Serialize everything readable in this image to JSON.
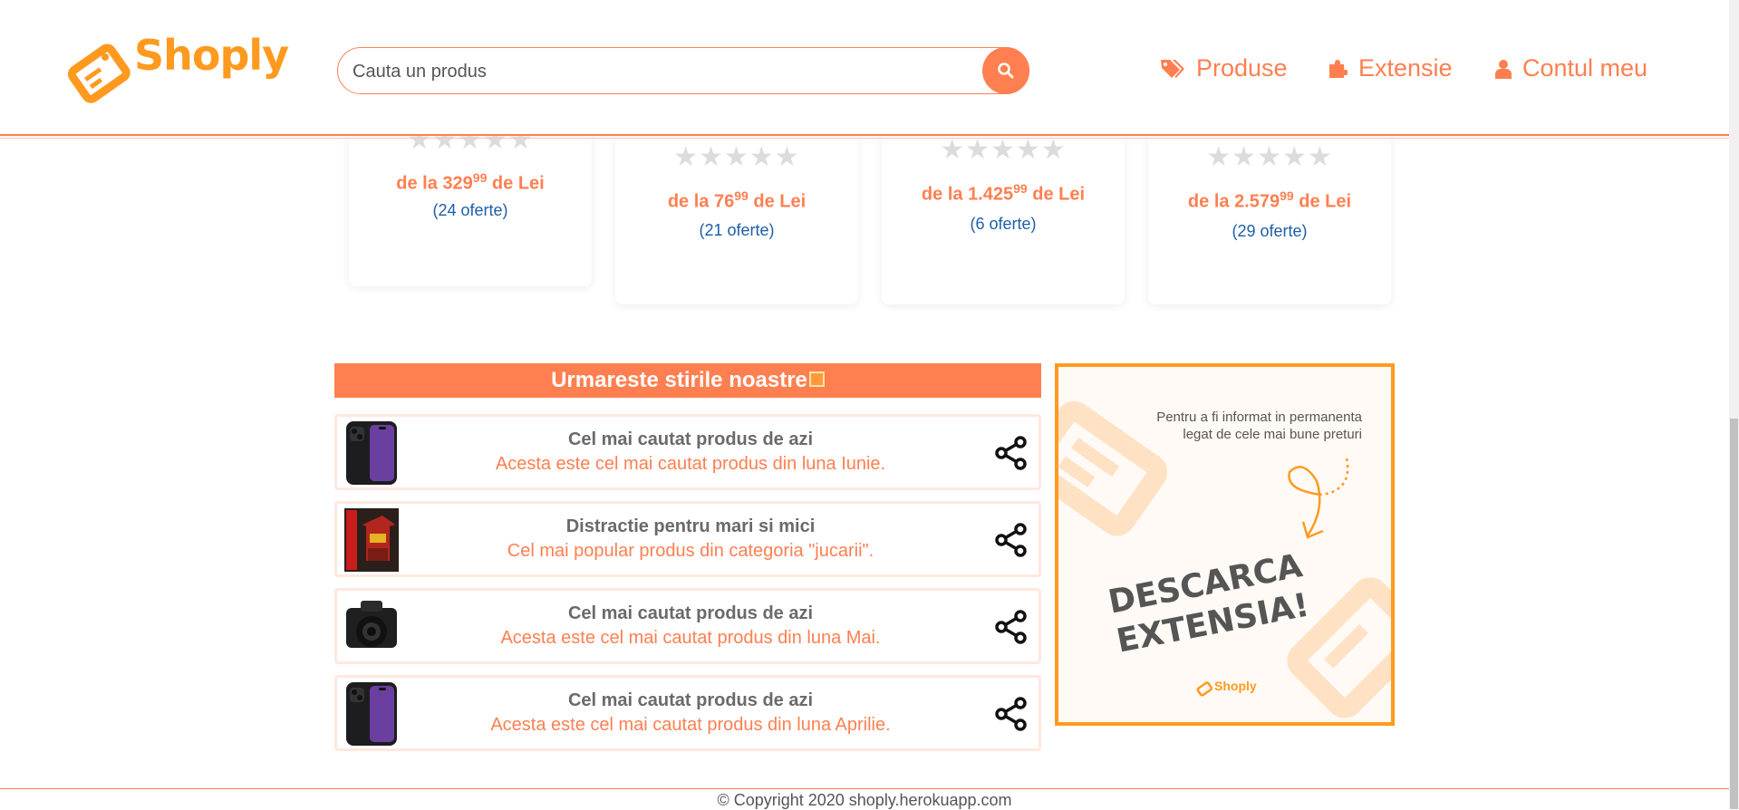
{
  "header": {
    "logo_text": "Shoply",
    "search": {
      "placeholder": "Cauta un produs",
      "value": ""
    },
    "nav": [
      {
        "label": "Produse",
        "icon": "tags-icon"
      },
      {
        "label": "Extensie",
        "icon": "puzzle-icon"
      },
      {
        "label": "Contul meu",
        "icon": "user-icon"
      }
    ]
  },
  "products": [
    {
      "stars": "★★★★★",
      "price_prefix": "de la ",
      "price_main": "329",
      "price_cents": "99",
      "price_suffix": " de Lei",
      "offers": "(24 oferte)"
    },
    {
      "stars": "★★★★★",
      "price_prefix": "de la ",
      "price_main": "76",
      "price_cents": "99",
      "price_suffix": " de Lei",
      "offers": "(21 oferte)"
    },
    {
      "stars": "★★★★★",
      "price_prefix": "de la ",
      "price_main": "1.425",
      "price_cents": "99",
      "price_suffix": " de Lei",
      "offers": "(6 oferte)"
    },
    {
      "stars": "★★★★★",
      "price_prefix": "de la ",
      "price_main": "2.579",
      "price_cents": "99",
      "price_suffix": " de Lei",
      "offers": "(29 oferte)"
    }
  ],
  "news": {
    "title": "Urmareste stirile noastre",
    "items": [
      {
        "title": "Cel mai cautat produs de azi",
        "desc": "Acesta este cel mai cautat produs din luna Iunie.",
        "image": "phone-image"
      },
      {
        "title": "Distractie pentru mari si mici",
        "desc": "Cel mai popular produs din categoria \"jucarii\".",
        "image": "lego-box-image"
      },
      {
        "title": "Cel mai cautat produs de azi",
        "desc": "Acesta este cel mai cautat produs din luna Mai.",
        "image": "camera-image"
      },
      {
        "title": "Cel mai cautat produs de azi",
        "desc": "Acesta este cel mai cautat produs din luna Aprilie.",
        "image": "phone-image"
      }
    ]
  },
  "ad": {
    "line1": "Pentru a fi informat in permanenta",
    "line2": "legat de cele mai bune preturi",
    "cta_line1": "DESCARCA",
    "cta_line2": "EXTENSIA!",
    "brand": "Shoply"
  },
  "footer": {
    "copyright": "© Copyright 2020 shoply.herokuapp.com"
  },
  "colors": {
    "accent": "#ff7f50",
    "logo": "#ff9a1f",
    "link": "#1e5ea8"
  }
}
